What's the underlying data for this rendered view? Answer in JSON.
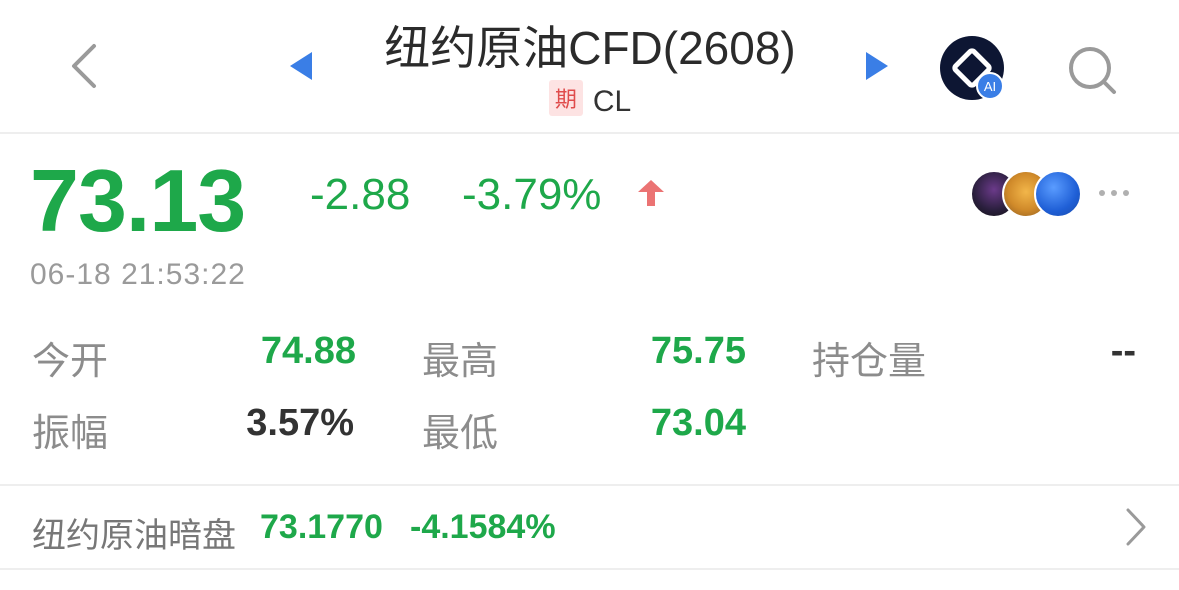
{
  "header": {
    "title": "纽约原油CFD(2608)",
    "tag": "期",
    "symbol": "CL",
    "ai_badge": "AI",
    "icons": [
      "back-icon",
      "prev-arrow-icon",
      "next-arrow-icon",
      "ai-assistant-icon",
      "search-icon"
    ]
  },
  "quote": {
    "price": "73.13",
    "change": "-2.88",
    "change_pct": "-3.79%",
    "timestamp": "06-18 21:53:22"
  },
  "stats": {
    "open_label": "今开",
    "open_value": "74.88",
    "high_label": "最高",
    "high_value": "75.75",
    "oi_label": "持仓量",
    "oi_value": "--",
    "amplitude_label": "振幅",
    "amplitude_value": "3.57%",
    "low_label": "最低",
    "low_value": "73.04"
  },
  "dark_pool": {
    "label": "纽约原油暗盘",
    "value": "73.1770",
    "change_pct": "-4.1584%"
  },
  "colors": {
    "down_green": "#1ea84a",
    "arrow_blue": "#3a7ee6",
    "up_red": "#e85a5a",
    "label_gray": "#8c8c8c"
  }
}
